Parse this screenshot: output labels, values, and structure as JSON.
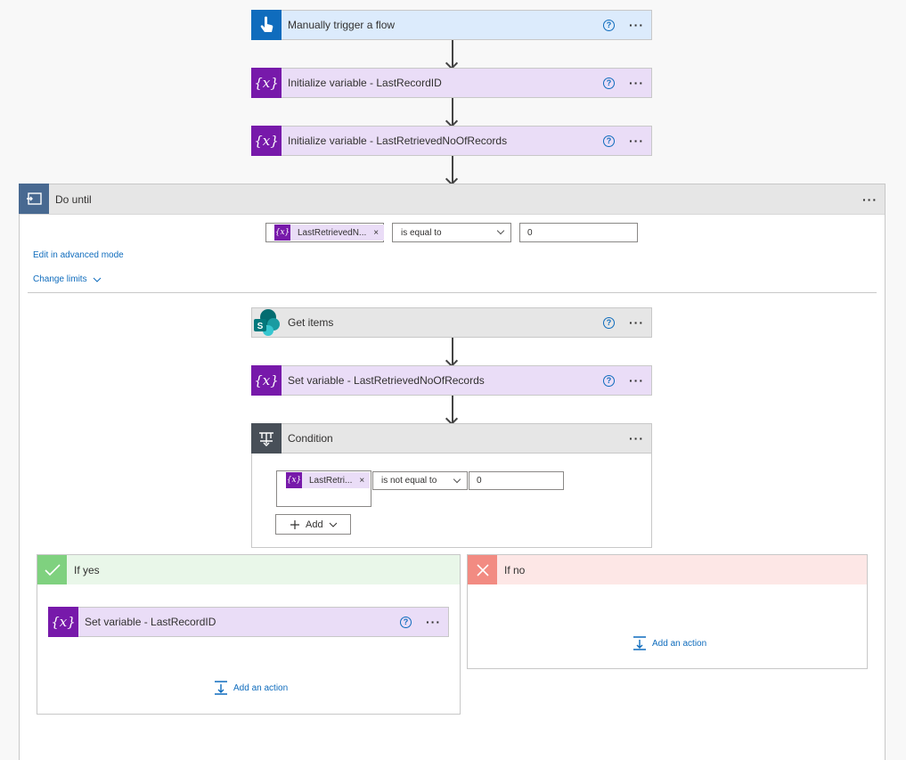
{
  "steps": {
    "trigger": {
      "title": "Manually trigger a flow",
      "icon": "hand-pointer-icon"
    },
    "init1": {
      "title": "Initialize variable - LastRecordID",
      "icon": "variable-icon"
    },
    "init2": {
      "title": "Initialize variable - LastRetrievedNoOfRecords",
      "icon": "variable-icon"
    }
  },
  "do_until": {
    "title": "Do until",
    "icon": "loop-icon",
    "condition": {
      "token": "LastRetrievedN...",
      "operator": "is equal to",
      "value": "0"
    },
    "edit_advanced": "Edit in advanced mode",
    "change_limits": "Change limits",
    "get_items": {
      "title": "Get items",
      "icon": "sharepoint-icon"
    },
    "set_var": {
      "title": "Set variable - LastRetrievedNoOfRecords"
    },
    "condition_card": {
      "title": "Condition",
      "icon": "condition-icon",
      "token": "LastRetri...",
      "operator": "is not equal to",
      "value": "0",
      "add_label": "Add"
    },
    "if_yes": {
      "title": "If yes",
      "set_var": "Set variable - LastRecordID",
      "add_action": "Add an action"
    },
    "if_no": {
      "title": "If no",
      "add_action": "Add an action"
    }
  },
  "common": {
    "help": "?",
    "more": "···",
    "token_x": "×",
    "var_glyph": "{x}"
  },
  "colors": {
    "trigger": "#0f6cbd",
    "variable": "#7719aa",
    "loop": "#486991",
    "yes": "#7fd17f",
    "no": "#f28b82",
    "link": "#0f6cbd"
  }
}
